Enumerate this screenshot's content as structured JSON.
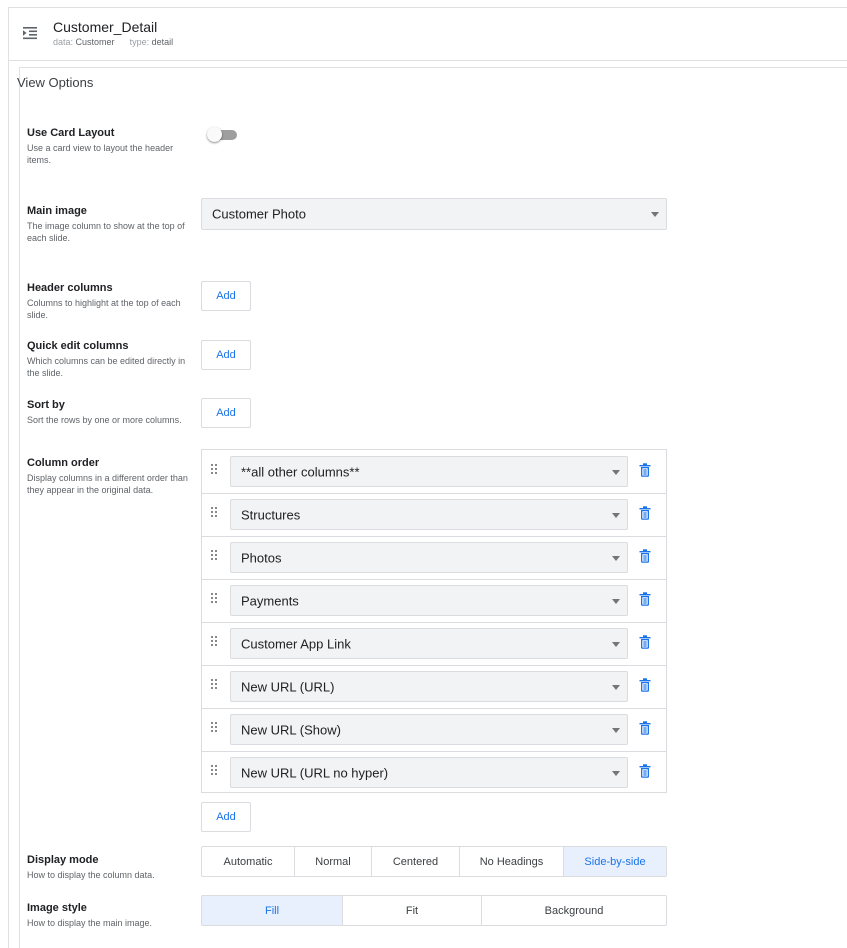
{
  "header": {
    "title": "Customer_Detail",
    "data_label": "data:",
    "data_value": "Customer",
    "type_label": "type:",
    "type_value": "detail"
  },
  "section_title": "View Options",
  "card_layout": {
    "label": "Use Card Layout",
    "description": "Use a card view to layout the header items.",
    "enabled": false
  },
  "main_image": {
    "label": "Main image",
    "description": "The image column to show at the top of each slide.",
    "value": "Customer Photo"
  },
  "header_columns": {
    "label": "Header columns",
    "description": "Columns to highlight at the top of each slide.",
    "add_label": "Add"
  },
  "quick_edit_columns": {
    "label": "Quick edit columns",
    "description": "Which columns can be edited directly in the slide.",
    "add_label": "Add"
  },
  "sort_by": {
    "label": "Sort by",
    "description": "Sort the rows by one or more columns.",
    "add_label": "Add"
  },
  "column_order": {
    "label": "Column order",
    "description": "Display columns in a different order than they appear in the original data.",
    "items": [
      "**all other columns**",
      "Structures",
      "Photos",
      "Payments",
      "Customer App Link",
      "New URL (URL)",
      "New URL (Show)",
      "New URL (URL no hyper)"
    ],
    "add_label": "Add"
  },
  "display_mode": {
    "label": "Display mode",
    "description": "How to display the column data.",
    "options": [
      "Automatic",
      "Normal",
      "Centered",
      "No Headings",
      "Side-by-side"
    ],
    "selected": "Side-by-side"
  },
  "image_style": {
    "label": "Image style",
    "description": "How to display the main image.",
    "options": [
      "Fill",
      "Fit",
      "Background"
    ],
    "selected": "Fill"
  },
  "colors": {
    "accent": "#1a73e8",
    "selected_bg": "#e8f0fe",
    "select_bg": "#f1f3f4",
    "border": "#dadce0"
  },
  "icons": {
    "menu": "menu-open-icon",
    "drag": "drag-handle-icon",
    "delete": "trash-icon",
    "caret": "caret-down-icon"
  }
}
